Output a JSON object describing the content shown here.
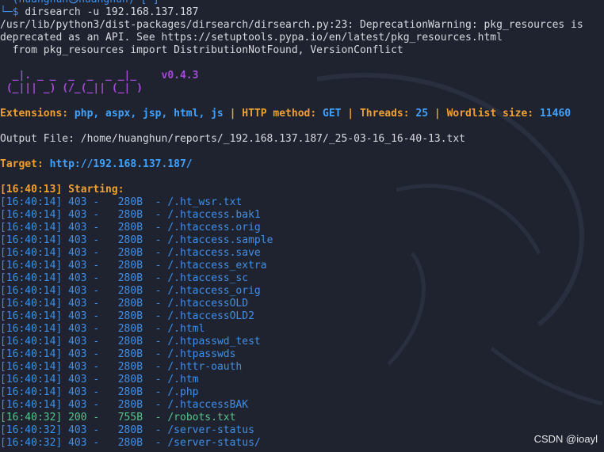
{
  "prompt": {
    "top_line": "  (huanghun㉿huanghun)-[~]",
    "arrow": "└─$ ",
    "command": "dirsearch -u 192.168.137.187"
  },
  "warning": [
    "/usr/lib/python3/dist-packages/dirsearch/dirsearch.py:23: DeprecationWarning: pkg_resources is",
    "deprecated as an API. See https://setuptools.pypa.io/en/latest/pkg_resources.html",
    "  from pkg_resources import DistributionNotFound, VersionConflict"
  ],
  "banner": {
    "line1": "  _|. _ _  _  _  _ _|_    v0.4.3",
    "line2": " (_||| _) (/_(_|| (_| )"
  },
  "config": {
    "extensions_label": "Extensions: ",
    "extensions_value": "php, aspx, jsp, html, js",
    "sep": " | ",
    "method_label": "HTTP method: ",
    "method_value": "GET",
    "threads_label": "Threads: ",
    "threads_value": "25",
    "wordlist_label": "Wordlist size: ",
    "wordlist_value": "11460"
  },
  "output_file": "Output File: /home/huanghun/reports/_192.168.137.187/_25-03-16_16-40-13.txt",
  "target": {
    "label": "Target: ",
    "url": "http://192.168.137.187/"
  },
  "starting": "[16:40:13] Starting:",
  "results": [
    {
      "time": "[16:40:14]",
      "status": "403",
      "size": "280B",
      "path": "/.ht_wsr.txt"
    },
    {
      "time": "[16:40:14]",
      "status": "403",
      "size": "280B",
      "path": "/.htaccess.bak1"
    },
    {
      "time": "[16:40:14]",
      "status": "403",
      "size": "280B",
      "path": "/.htaccess.orig"
    },
    {
      "time": "[16:40:14]",
      "status": "403",
      "size": "280B",
      "path": "/.htaccess.sample"
    },
    {
      "time": "[16:40:14]",
      "status": "403",
      "size": "280B",
      "path": "/.htaccess.save"
    },
    {
      "time": "[16:40:14]",
      "status": "403",
      "size": "280B",
      "path": "/.htaccess_extra"
    },
    {
      "time": "[16:40:14]",
      "status": "403",
      "size": "280B",
      "path": "/.htaccess_sc"
    },
    {
      "time": "[16:40:14]",
      "status": "403",
      "size": "280B",
      "path": "/.htaccess_orig"
    },
    {
      "time": "[16:40:14]",
      "status": "403",
      "size": "280B",
      "path": "/.htaccessOLD"
    },
    {
      "time": "[16:40:14]",
      "status": "403",
      "size": "280B",
      "path": "/.htaccessOLD2"
    },
    {
      "time": "[16:40:14]",
      "status": "403",
      "size": "280B",
      "path": "/.html"
    },
    {
      "time": "[16:40:14]",
      "status": "403",
      "size": "280B",
      "path": "/.htpasswd_test"
    },
    {
      "time": "[16:40:14]",
      "status": "403",
      "size": "280B",
      "path": "/.htpasswds"
    },
    {
      "time": "[16:40:14]",
      "status": "403",
      "size": "280B",
      "path": "/.httr-oauth"
    },
    {
      "time": "[16:40:14]",
      "status": "403",
      "size": "280B",
      "path": "/.htm"
    },
    {
      "time": "[16:40:14]",
      "status": "403",
      "size": "280B",
      "path": "/.php"
    },
    {
      "time": "[16:40:14]",
      "status": "403",
      "size": "280B",
      "path": "/.htaccessBAK"
    },
    {
      "time": "[16:40:32]",
      "status": "200",
      "size": "755B",
      "path": "/robots.txt"
    },
    {
      "time": "[16:40:32]",
      "status": "403",
      "size": "280B",
      "path": "/server-status"
    },
    {
      "time": "[16:40:32]",
      "status": "403",
      "size": "280B",
      "path": "/server-status/"
    }
  ],
  "watermark": "CSDN @ioayl",
  "colors": {
    "background": "#1f2330",
    "blue": "#3f8fe8",
    "orange": "#f0a030",
    "purple": "#a64ad8",
    "green": "#56c48a"
  }
}
